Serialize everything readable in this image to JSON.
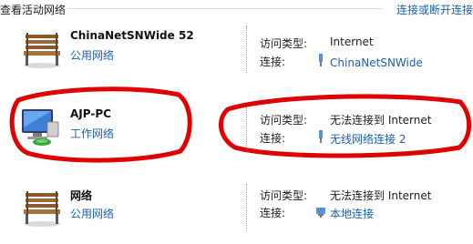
{
  "header": {
    "title": "查看活动网络",
    "right_link": "连接或断开连接"
  },
  "networks": [
    {
      "name": "ChinaNetSNWide  52",
      "type": "公用网络",
      "icon": "bench-icon",
      "access_label": "访问类型:",
      "access_value": "Internet",
      "conn_label": "连接:",
      "conn_value": "ChinaNetSNWide",
      "conn_icon": "wireless-adapter-icon"
    },
    {
      "name": "AJP-PC",
      "type": "工作网络",
      "icon": "work-network-icon",
      "access_label": "访问类型:",
      "access_value": "无法连接到 Internet",
      "conn_label": "连接:",
      "conn_value": "无线网络连接 2",
      "conn_icon": "wireless-adapter-icon"
    },
    {
      "name": "网络",
      "type": "公用网络",
      "icon": "bench-icon",
      "access_label": "访问类型:",
      "access_value": "无法连接到 Internet",
      "conn_label": "连接:",
      "conn_value": "本地连接",
      "conn_icon": "wired-adapter-icon"
    }
  ],
  "colors": {
    "link": "#1a5fb4",
    "annotation": "#e00000"
  }
}
